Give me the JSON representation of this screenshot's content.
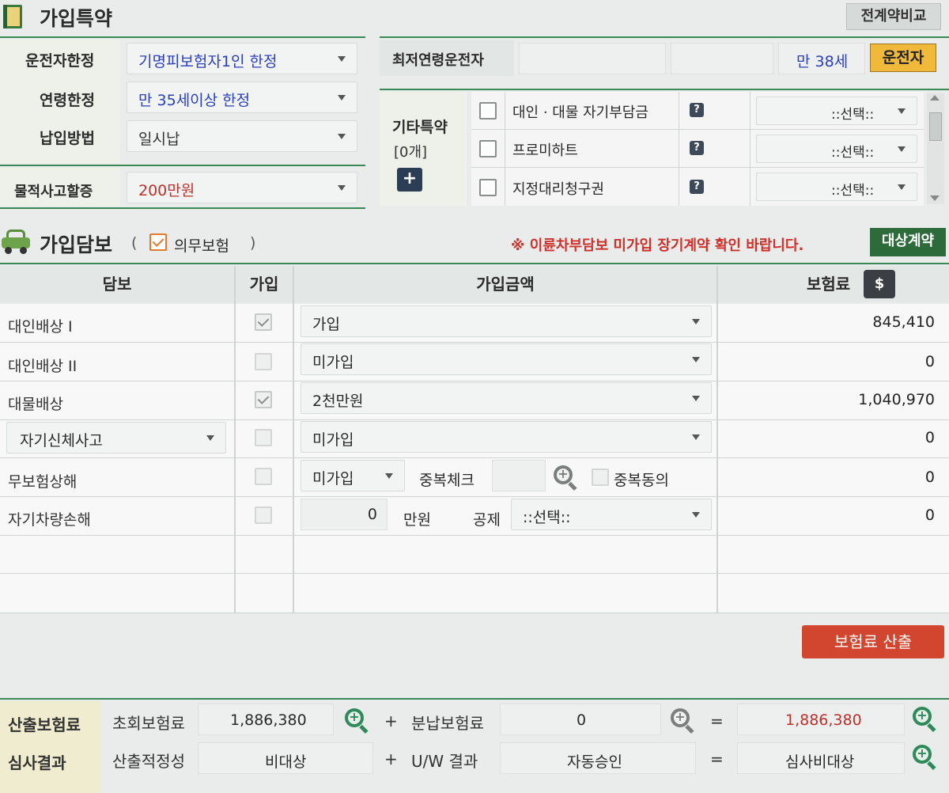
{
  "header": {
    "section_title": "가입특약",
    "compare_button": "전계약비교"
  },
  "special": {
    "driver_limit_label": "운전자한정",
    "driver_limit_value": "기명피보험자1인 한정",
    "age_limit_label": "연령한정",
    "age_limit_value": "만 35세이상 한정",
    "payment_label": "납입방법",
    "payment_value": "일시납",
    "property_label": "물적사고할증",
    "property_value": "200만원",
    "youngest_driver_label": "최저연령운전자",
    "youngest_driver_age": "만 38세",
    "driver_button": "운전자",
    "other_label": "기타특약",
    "other_count": "[0개]",
    "add_button": "+",
    "other_items": [
      {
        "label": "대인 · 대물 자기부담금",
        "select": "::선택::"
      },
      {
        "label": "프로미하트",
        "select": "::선택::"
      },
      {
        "label": "지정대리청구권",
        "select": "::선택::"
      }
    ]
  },
  "coverage": {
    "title": "가입담보",
    "mandatory_open": "(",
    "mandatory_label": "의무보험",
    "mandatory_close": ")",
    "warning": "※ 이륜차부담보 미가입 장기계약 확인 바랍니다.",
    "target_button": "대상계약",
    "columns": {
      "item": "담보",
      "join": "가입",
      "amount": "가입금액",
      "premium": "보험료",
      "currency_icon": "$"
    },
    "rows": [
      {
        "label": "대인배상 I",
        "checked": true,
        "amount": "가입",
        "premium": "845,410"
      },
      {
        "label": "대인배상 II",
        "checked": false,
        "amount": "미가입",
        "premium": "0"
      },
      {
        "label": "대물배상",
        "checked": true,
        "amount": "2천만원",
        "premium": "1,040,970"
      },
      {
        "label": "자기신체사고",
        "checked": false,
        "amount": "미가입",
        "premium": "0"
      },
      {
        "label": "무보험상해",
        "checked": false,
        "amount": "미가입",
        "premium": "0"
      },
      {
        "label": "자기차량손해",
        "checked": false,
        "amount": "0",
        "premium": "0"
      }
    ],
    "dup_check_label": "중복체크",
    "dup_agree_label": "중복동의",
    "unit_label": "만원",
    "deduct_label": "공제",
    "deduct_select": "::선택::",
    "calc_button": "보험료 산출"
  },
  "summary": {
    "calc_label": "산출보험료",
    "first_label": "초회보험료",
    "first_value": "1,886,380",
    "plus": "+",
    "install_label": "분납보험료",
    "install_value": "0",
    "equals": "=",
    "total_value": "1,886,380",
    "review_label": "심사결과",
    "adequacy_label": "산출적정성",
    "adequacy_value": "비대상",
    "uw_label": "U/W 결과",
    "uw_value": "자동승인",
    "review_value": "심사비대상"
  },
  "colors": {
    "accent_green": "#2f8a5a",
    "warning_red": "#d0302a",
    "blue_value": "#2a3fbf",
    "button_red": "#d2452e",
    "driver_btn": "#f0b93a"
  }
}
